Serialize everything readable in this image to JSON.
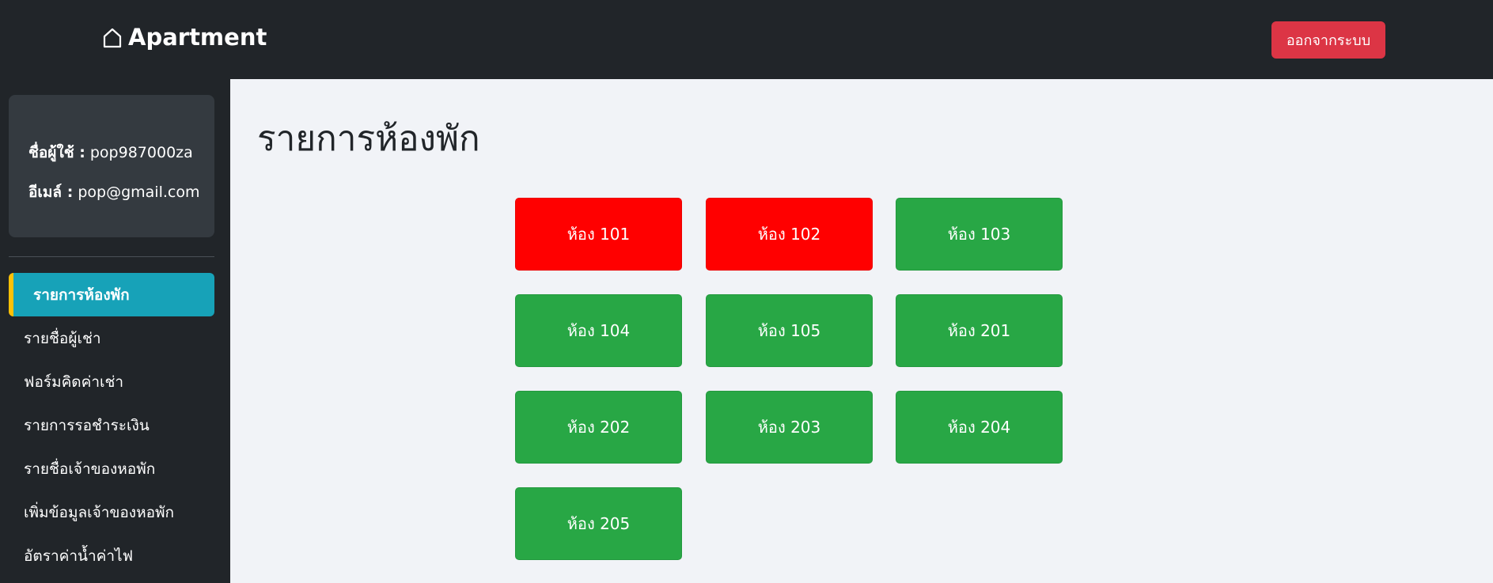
{
  "header": {
    "brand": "Apartment",
    "logout_label": "ออกจากระบบ",
    "colors": {
      "background": "#212529",
      "logout": "#dc3545"
    }
  },
  "sidebar": {
    "user": {
      "username_label": "ชื่อผู้ใช้ :",
      "username": "pop987000za",
      "email_label": "อีเมล์ :",
      "email": "pop@gmail.com"
    },
    "items": [
      {
        "label": "รายการห้องพัก",
        "active": true
      },
      {
        "label": "รายชื่อผู้เช่า",
        "active": false
      },
      {
        "label": "ฟอร์มคิดค่าเช่า",
        "active": false
      },
      {
        "label": "รายการรอชำระเงิน",
        "active": false
      },
      {
        "label": "รายชื่อเจ้าของหอพัก",
        "active": false
      },
      {
        "label": "เพิ่มข้อมูลเจ้าของหอพัก",
        "active": false
      },
      {
        "label": "อัตราค่าน้ำค่าไฟ",
        "active": false
      }
    ],
    "colors": {
      "active": "#17a2b8",
      "active_marker": "#ffc107"
    }
  },
  "main": {
    "title": "รายการห้องพัก",
    "rooms": [
      {
        "label": "ห้อง 101",
        "status": "occupied"
      },
      {
        "label": "ห้อง 102",
        "status": "occupied"
      },
      {
        "label": "ห้อง 103",
        "status": "vacant"
      },
      {
        "label": "ห้อง 104",
        "status": "vacant"
      },
      {
        "label": "ห้อง 105",
        "status": "vacant"
      },
      {
        "label": "ห้อง 201",
        "status": "vacant"
      },
      {
        "label": "ห้อง 202",
        "status": "vacant"
      },
      {
        "label": "ห้อง 203",
        "status": "vacant"
      },
      {
        "label": "ห้อง 204",
        "status": "vacant"
      },
      {
        "label": "ห้อง 205",
        "status": "vacant"
      }
    ],
    "colors": {
      "occupied": "#ff0000",
      "vacant": "#28a745"
    }
  }
}
